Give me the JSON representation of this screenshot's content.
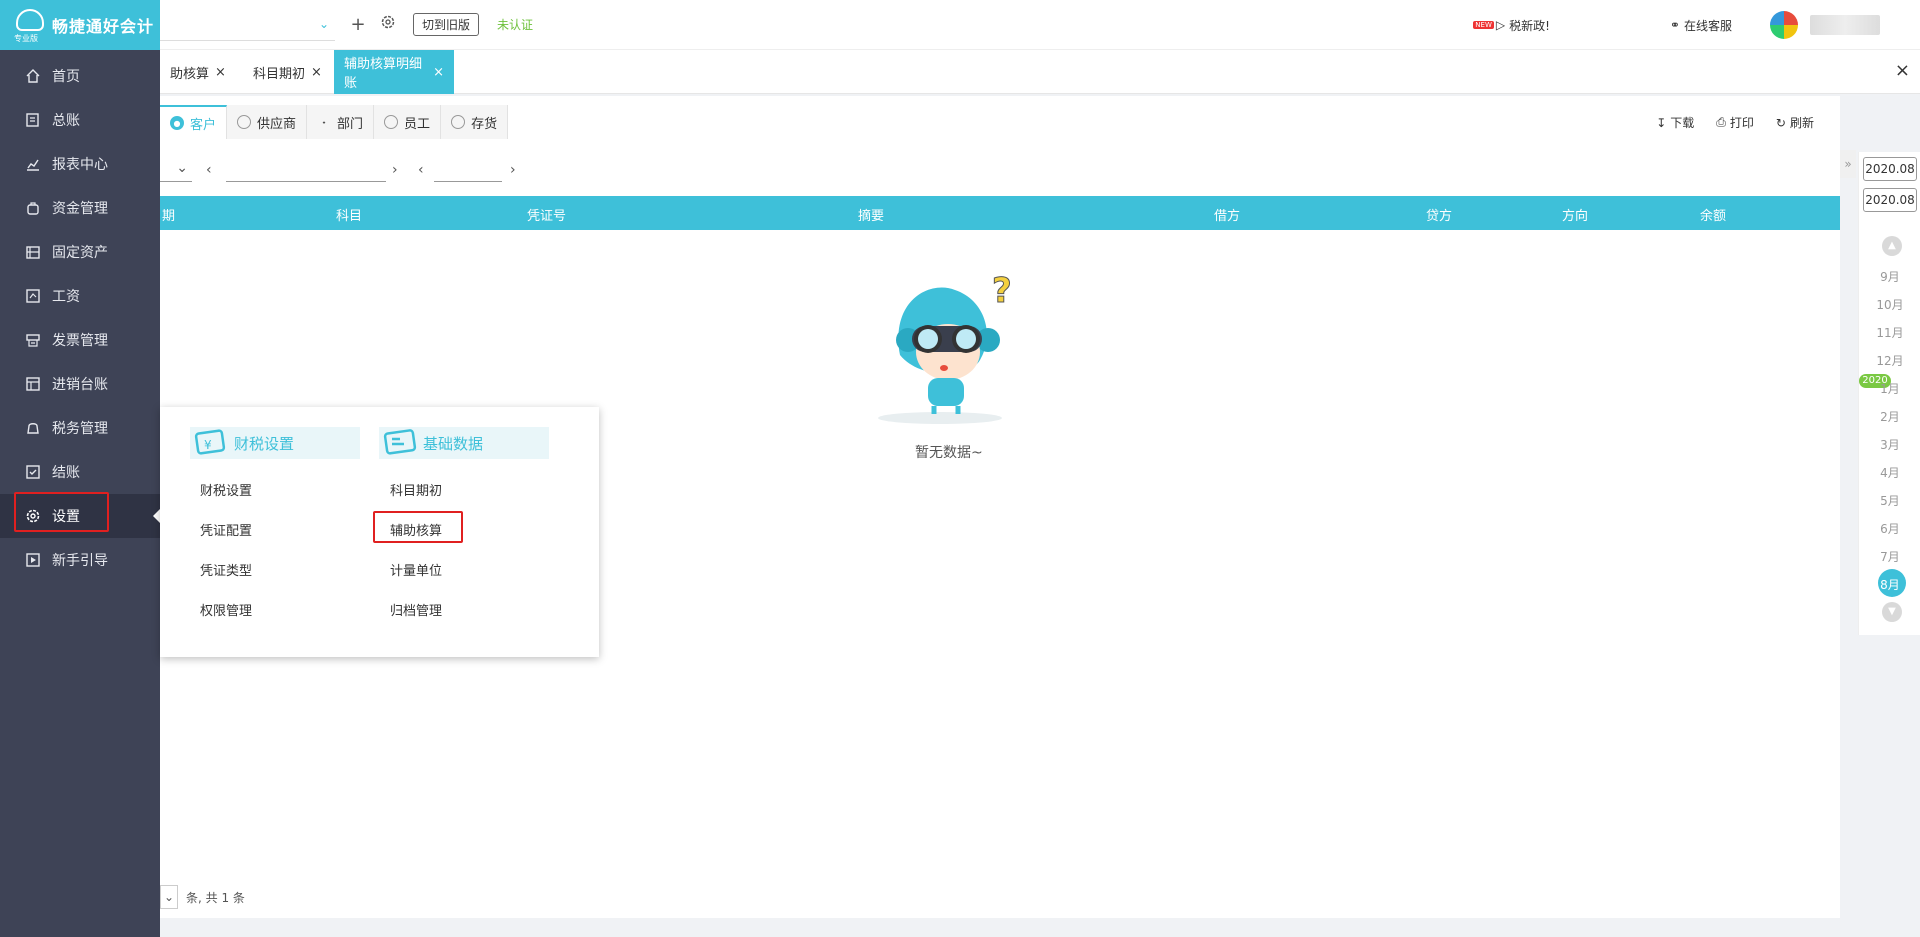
{
  "app": {
    "name": "畅捷通好会计",
    "edition": "专业版"
  },
  "sidebar": {
    "items": [
      {
        "label": "首页",
        "icon": "home-icon"
      },
      {
        "label": "总账",
        "icon": "ledger-icon"
      },
      {
        "label": "报表中心",
        "icon": "report-icon"
      },
      {
        "label": "资金管理",
        "icon": "funds-icon"
      },
      {
        "label": "固定资产",
        "icon": "asset-icon"
      },
      {
        "label": "工资",
        "icon": "salary-icon"
      },
      {
        "label": "发票管理",
        "icon": "invoice-icon"
      },
      {
        "label": "进销台账",
        "icon": "inventory-icon"
      },
      {
        "label": "税务管理",
        "icon": "tax-icon"
      },
      {
        "label": "结账",
        "icon": "close-books-icon"
      },
      {
        "label": "设置",
        "icon": "gear-icon",
        "active": true
      },
      {
        "label": "新手引导",
        "icon": "guide-icon"
      }
    ]
  },
  "topbar": {
    "switch_old": "切到旧版",
    "unverified": "未认证",
    "news_badge": "NEW",
    "news": "税新政!",
    "service": "在线客服"
  },
  "tabs": [
    {
      "label": "助核算"
    },
    {
      "label": "科目期初"
    },
    {
      "label": "辅助核算明细账",
      "active": true
    }
  ],
  "subtabs": [
    {
      "label": "客户",
      "active": true
    },
    {
      "label": "供应商"
    },
    {
      "label": "部门"
    },
    {
      "label": "员工"
    },
    {
      "label": "存货"
    }
  ],
  "actions": {
    "download": "下载",
    "print": "打印",
    "refresh": "刷新"
  },
  "table": {
    "headers": [
      "期",
      "科目",
      "凭证号",
      "摘要",
      "借方",
      "贷方",
      "方向",
      "余额"
    ]
  },
  "empty_text": "暂无数据~",
  "pager": {
    "summary": "条, 共 1 条"
  },
  "dropdown": {
    "group1_title": "财税设置",
    "group1_items": [
      "财税设置",
      "凭证配置",
      "凭证类型",
      "权限管理"
    ],
    "group2_title": "基础数据",
    "group2_items": [
      "科目期初",
      "辅助核算",
      "计量单位",
      "归档管理"
    ]
  },
  "rail": {
    "date_from": "2020.08",
    "date_to": "2020.08",
    "year": "2020",
    "months": [
      "9月",
      "10月",
      "11月",
      "12月",
      "1月",
      "2月",
      "3月",
      "4月",
      "5月",
      "6月",
      "7月",
      "8月"
    ],
    "current_month": "8月"
  },
  "colors": {
    "accent": "#3ec0d9",
    "sidebar": "#3e4356",
    "highlight": "#e02020",
    "year_badge": "#7ac943"
  }
}
